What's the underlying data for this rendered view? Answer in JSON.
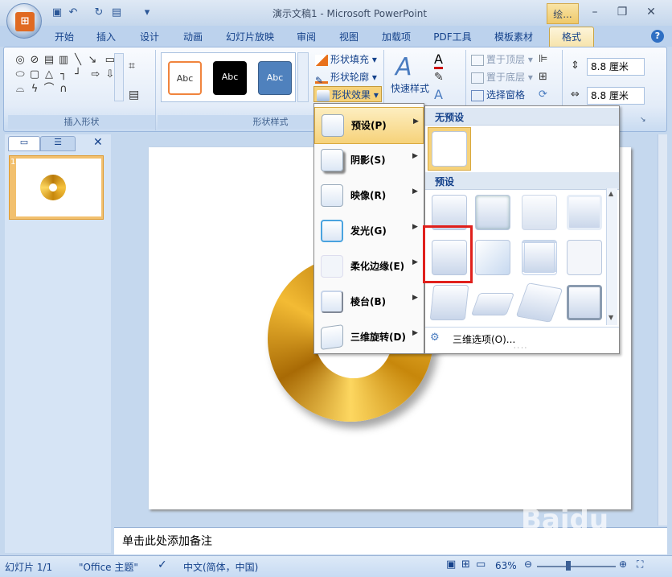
{
  "window": {
    "title": "演示文稿1 - Microsoft PowerPoint",
    "context_tab": "绘..."
  },
  "tabs": [
    "开始",
    "插入",
    "设计",
    "动画",
    "幻灯片放映",
    "审阅",
    "视图",
    "加载项",
    "PDF工具",
    "模板素材",
    "格式"
  ],
  "ribbon": {
    "groups": {
      "insert_shapes": "插入形状",
      "shape_styles": "形状样式"
    },
    "style_samples": [
      "Abc",
      "Abc",
      "Abc"
    ],
    "buttons": {
      "shape_fill": "形状填充",
      "shape_outline": "形状轮廓",
      "shape_effects": "形状效果",
      "quick_styles": "快速样式",
      "bring_to_front": "置于顶层",
      "send_to_back": "置于底层",
      "selection_pane": "选择窗格"
    },
    "size": {
      "height": "8.8 厘米",
      "width": "8.8 厘米"
    }
  },
  "effects_menu": [
    {
      "label": "预设(P)",
      "icon": "preset-icon"
    },
    {
      "label": "阴影(S)",
      "icon": "shadow-icon"
    },
    {
      "label": "映像(R)",
      "icon": "reflection-icon"
    },
    {
      "label": "发光(G)",
      "icon": "glow-icon"
    },
    {
      "label": "柔化边缘(E)",
      "icon": "soft-edges-icon"
    },
    {
      "label": "棱台(B)",
      "icon": "bevel-icon"
    },
    {
      "label": "三维旋转(D)",
      "icon": "3d-rotation-icon"
    }
  ],
  "preset_panel": {
    "no_preset_header": "无预设",
    "preset_header": "预设",
    "options_label": "三维选项(O)..."
  },
  "slide_pane": {
    "slide_number": "1"
  },
  "notes": {
    "placeholder": "单击此处添加备注"
  },
  "statusbar": {
    "slide_info": "幻灯片 1/1",
    "theme": "\"Office 主题\"",
    "language": "中文(简体，中国)",
    "zoom": "63%"
  },
  "watermark": "Baidu 经验",
  "colors": {
    "accent": "#15428b",
    "highlight": "#f6d27a",
    "selection_box": "#e0201c",
    "donut": "#e3a81c"
  }
}
